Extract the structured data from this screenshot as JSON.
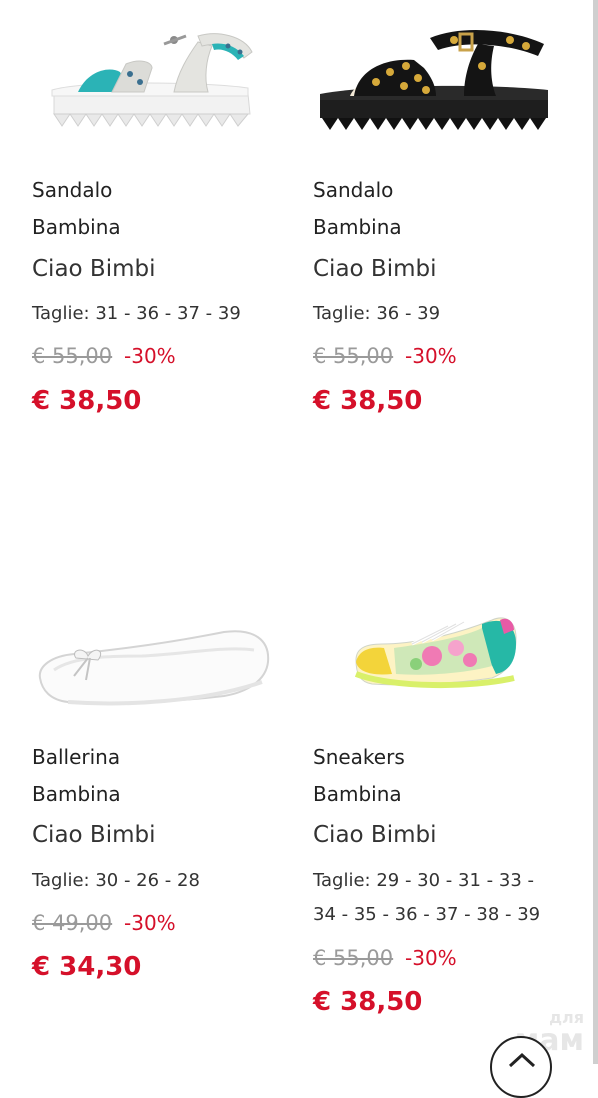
{
  "products": [
    {
      "category_line1": "Sandalo",
      "category_line2": "Bambina",
      "brand": "Ciao Bimbi",
      "sizes": "Taglie: 31 - 36 - 37 - 39",
      "old_price": "€ 55,00",
      "discount": "-30%",
      "price": "€ 38,50",
      "image": "white-sandal-with-teal-strap"
    },
    {
      "category_line1": "Sandalo",
      "category_line2": "Bambina",
      "brand": "Ciao Bimbi",
      "sizes": "Taglie: 36 - 39",
      "old_price": "€ 55,00",
      "discount": "-30%",
      "price": "€ 38,50",
      "image": "black-sandal-with-gold-studs"
    },
    {
      "category_line1": "Ballerina",
      "category_line2": "Bambina",
      "brand": "Ciao Bimbi",
      "sizes": "Taglie: 30 - 26 - 28",
      "old_price": "€ 49,00",
      "discount": "-30%",
      "price": "€ 34,30",
      "image": "white-ballerina-flat"
    },
    {
      "category_line1": "Sneakers",
      "category_line2": "Bambina",
      "brand": "Ciao Bimbi",
      "sizes": "Taglie: 29 - 30 - 31 - 33 - 34 - 35 - 36 - 37 - 38 - 39",
      "old_price": "€ 55,00",
      "discount": "-30%",
      "price": "€ 38,50",
      "image": "floral-sneaker"
    }
  ],
  "watermark": {
    "line1": "для",
    "line2": "мам"
  },
  "scroll_top_icon": "chevron-up-icon",
  "colors": {
    "price_red": "#d5102a",
    "old_price_gray": "#9a9a9a"
  }
}
